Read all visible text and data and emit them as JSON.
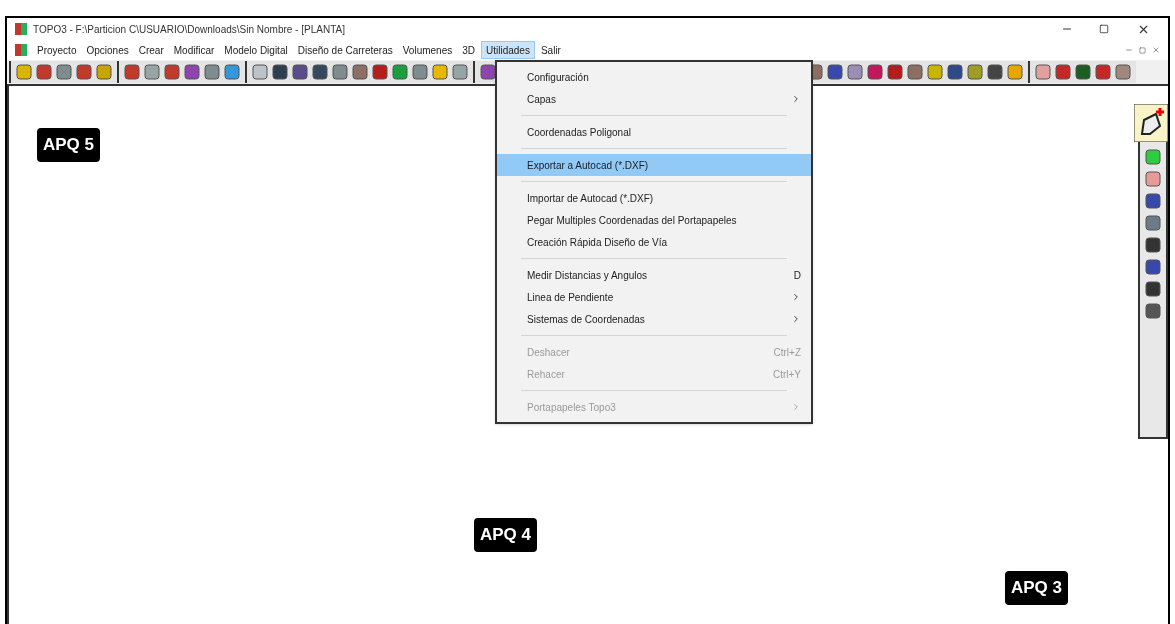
{
  "window": {
    "title": "TOPO3 - F:\\Particion C\\USUARIO\\Downloads\\Sin Nombre - [PLANTA]"
  },
  "menu_bar": [
    {
      "label": "Proyecto",
      "selected": false
    },
    {
      "label": "Opciones",
      "selected": false
    },
    {
      "label": "Crear",
      "selected": false
    },
    {
      "label": "Modificar",
      "selected": false
    },
    {
      "label": "Modelo Digital",
      "selected": false
    },
    {
      "label": "Diseño de Carreteras",
      "selected": false
    },
    {
      "label": "Volumenes",
      "selected": false
    },
    {
      "label": "3D",
      "selected": false
    },
    {
      "label": "Utilidades",
      "selected": true
    },
    {
      "label": "Salir",
      "selected": false
    }
  ],
  "dropdown": {
    "items": [
      {
        "kind": "item",
        "label": "Configuración",
        "submenu": false,
        "disabled": false,
        "selected": false
      },
      {
        "kind": "item",
        "label": "Capas",
        "submenu": true,
        "disabled": false,
        "selected": false
      },
      {
        "kind": "separator"
      },
      {
        "kind": "item",
        "label": "Coordenadas Poligonal",
        "submenu": false,
        "disabled": false,
        "selected": false
      },
      {
        "kind": "separator"
      },
      {
        "kind": "item",
        "label": "Exportar a Autocad (*.DXF)",
        "submenu": false,
        "disabled": false,
        "selected": true
      },
      {
        "kind": "separator"
      },
      {
        "kind": "item",
        "label": "Importar de Autocad (*.DXF)",
        "submenu": false,
        "disabled": false,
        "selected": false
      },
      {
        "kind": "item",
        "label": "Pegar Multiples Coordenadas del Portapapeles",
        "submenu": false,
        "disabled": false,
        "selected": false
      },
      {
        "kind": "item",
        "label": "Creación Rápida Diseño de Vía",
        "submenu": false,
        "disabled": false,
        "selected": false
      },
      {
        "kind": "separator"
      },
      {
        "kind": "item",
        "label": "Medir Distancias y Angulos",
        "shortcut": "D",
        "submenu": false,
        "disabled": false,
        "selected": false
      },
      {
        "kind": "item",
        "label": "Linea de Pendiente",
        "submenu": true,
        "disabled": false,
        "selected": false
      },
      {
        "kind": "item",
        "label": "Sistemas de Coordenadas",
        "submenu": true,
        "disabled": false,
        "selected": false
      },
      {
        "kind": "separator"
      },
      {
        "kind": "item",
        "label": "Deshacer",
        "shortcut": "Ctrl+Z",
        "submenu": false,
        "disabled": true,
        "selected": false
      },
      {
        "kind": "item",
        "label": "Rehacer",
        "shortcut": "Ctrl+Y",
        "submenu": false,
        "disabled": true,
        "selected": false
      },
      {
        "kind": "separator"
      },
      {
        "kind": "item",
        "label": "Portapapeles Topo3",
        "submenu": true,
        "disabled": true,
        "selected": false
      }
    ]
  },
  "canvas": {
    "labels": [
      {
        "text": "APQ 5"
      },
      {
        "text": "APQ 4"
      },
      {
        "text": "APQ 3"
      }
    ]
  }
}
